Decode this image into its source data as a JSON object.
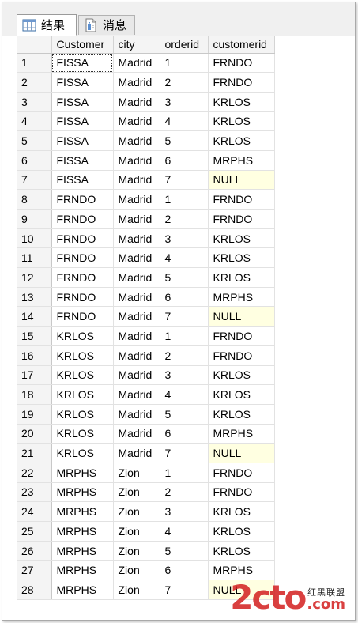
{
  "tabs": [
    {
      "label": "结果",
      "icon": "grid-icon",
      "active": true
    },
    {
      "label": "消息",
      "icon": "message-icon",
      "active": false
    }
  ],
  "columns": [
    "",
    "Customer",
    "city",
    "orderid",
    "customerid"
  ],
  "rows": [
    [
      "1",
      "FISSA",
      "Madrid",
      "1",
      "FRNDO"
    ],
    [
      "2",
      "FISSA",
      "Madrid",
      "2",
      "FRNDO"
    ],
    [
      "3",
      "FISSA",
      "Madrid",
      "3",
      "KRLOS"
    ],
    [
      "4",
      "FISSA",
      "Madrid",
      "4",
      "KRLOS"
    ],
    [
      "5",
      "FISSA",
      "Madrid",
      "5",
      "KRLOS"
    ],
    [
      "6",
      "FISSA",
      "Madrid",
      "6",
      "MRPHS"
    ],
    [
      "7",
      "FISSA",
      "Madrid",
      "7",
      "NULL"
    ],
    [
      "8",
      "FRNDO",
      "Madrid",
      "1",
      "FRNDO"
    ],
    [
      "9",
      "FRNDO",
      "Madrid",
      "2",
      "FRNDO"
    ],
    [
      "10",
      "FRNDO",
      "Madrid",
      "3",
      "KRLOS"
    ],
    [
      "11",
      "FRNDO",
      "Madrid",
      "4",
      "KRLOS"
    ],
    [
      "12",
      "FRNDO",
      "Madrid",
      "5",
      "KRLOS"
    ],
    [
      "13",
      "FRNDO",
      "Madrid",
      "6",
      "MRPHS"
    ],
    [
      "14",
      "FRNDO",
      "Madrid",
      "7",
      "NULL"
    ],
    [
      "15",
      "KRLOS",
      "Madrid",
      "1",
      "FRNDO"
    ],
    [
      "16",
      "KRLOS",
      "Madrid",
      "2",
      "FRNDO"
    ],
    [
      "17",
      "KRLOS",
      "Madrid",
      "3",
      "KRLOS"
    ],
    [
      "18",
      "KRLOS",
      "Madrid",
      "4",
      "KRLOS"
    ],
    [
      "19",
      "KRLOS",
      "Madrid",
      "5",
      "KRLOS"
    ],
    [
      "20",
      "KRLOS",
      "Madrid",
      "6",
      "MRPHS"
    ],
    [
      "21",
      "KRLOS",
      "Madrid",
      "7",
      "NULL"
    ],
    [
      "22",
      "MRPHS",
      "Zion",
      "1",
      "FRNDO"
    ],
    [
      "23",
      "MRPHS",
      "Zion",
      "2",
      "FRNDO"
    ],
    [
      "24",
      "MRPHS",
      "Zion",
      "3",
      "KRLOS"
    ],
    [
      "25",
      "MRPHS",
      "Zion",
      "4",
      "KRLOS"
    ],
    [
      "26",
      "MRPHS",
      "Zion",
      "5",
      "KRLOS"
    ],
    [
      "27",
      "MRPHS",
      "Zion",
      "6",
      "MRPHS"
    ],
    [
      "28",
      "MRPHS",
      "Zion",
      "7",
      "NULL"
    ]
  ],
  "watermark": {
    "main": "2cto",
    "cn": "红黑联盟",
    "com": ".com"
  },
  "colors": {
    "null_highlight": "#ffffe1",
    "header_bg": "#f4f4f4",
    "watermark_red": "#d21e1e"
  }
}
